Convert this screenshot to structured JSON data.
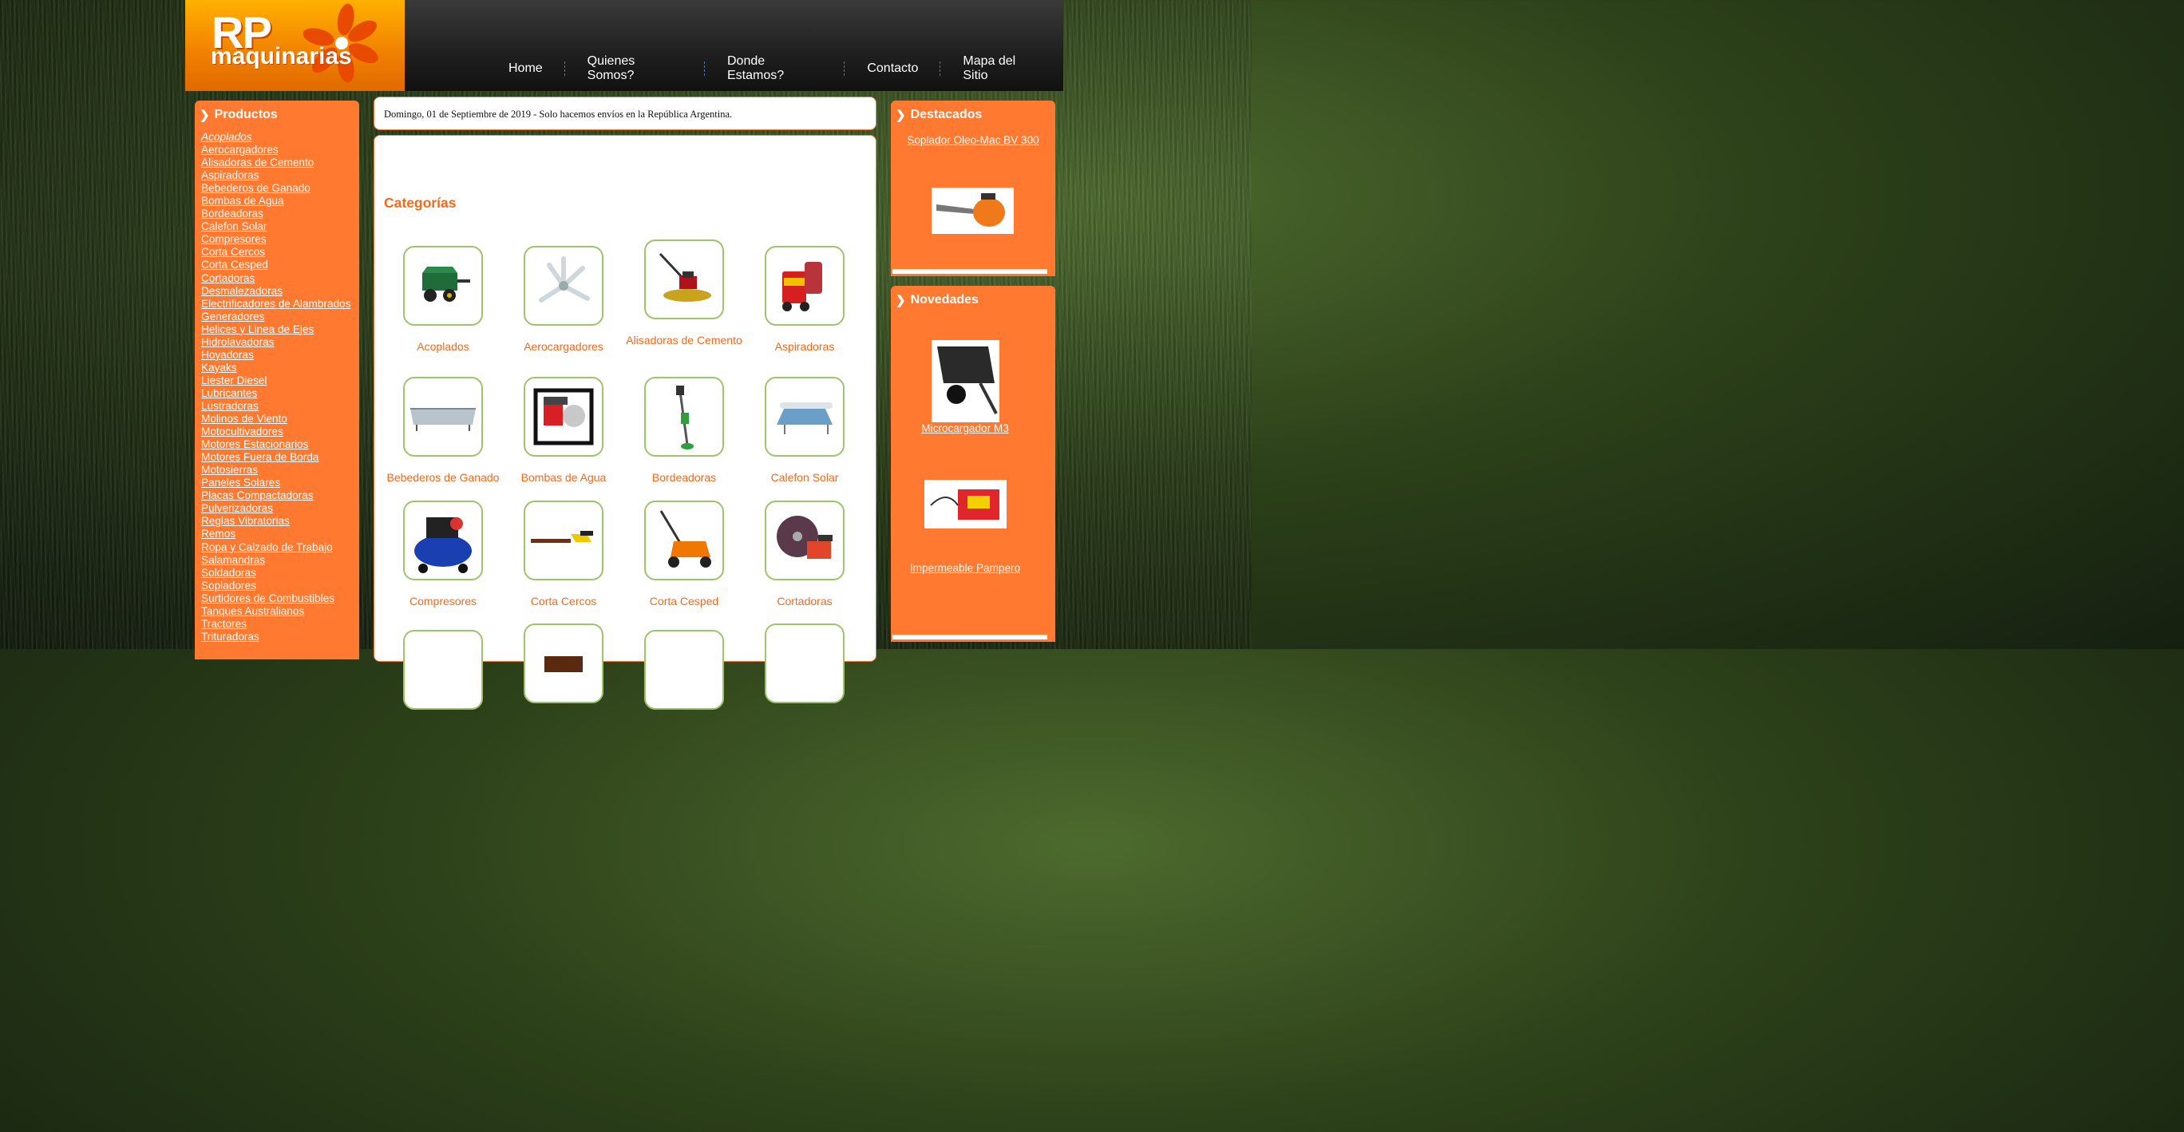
{
  "logo": {
    "line1": "RP",
    "line2": "maquinarias"
  },
  "nav": [
    "Home",
    "Quienes Somos?",
    "Donde Estamos?",
    "Contacto",
    "Mapa del Sitio"
  ],
  "products": {
    "title": "Productos",
    "items": [
      "Acoplados",
      "Aerocargadores",
      "Alisadoras de Cemento",
      "Aspiradoras",
      "Bebederos de Ganado",
      "Bombas de Agua",
      "Bordeadoras",
      "Calefon Solar",
      "Compresores",
      "Corta Cercos",
      "Corta Cesped",
      "Cortadoras",
      "Desmalezadoras",
      "Electrificadores de Alambrados",
      "Generadores",
      "Helices y Linea de Ejes",
      "Hidrolavadoras",
      "Hoyadoras",
      "Kayaks",
      "Liester Diesel",
      "Lubricantes",
      "Lustradoras",
      "Molinos de Viento",
      "Motocultivadores",
      "Motores Estacionarios",
      "Motores Fuera de Borda",
      "Motosierras",
      "Paneles Solares",
      "Placas Compactadoras",
      "Pulverizadoras",
      "Reglas Vibratorias",
      "Remos",
      "Ropa y Calzado de Trabajo",
      "Salamandras",
      "Soldadoras",
      "Sopladores",
      "Surtidores de Combustibles",
      "Tanques Australianos",
      "Tractores",
      "Trituradoras"
    ]
  },
  "date_notice": "Domingo, 01 de Septiembre de 2019  - Solo hacemos envíos en la República Argentina.",
  "categories": {
    "title": "Categorías",
    "items": [
      "Acoplados",
      "Aerocargadores",
      "Alisadoras de Cemento",
      "Aspiradoras",
      "Bebederos de Ganado",
      "Bombas de Agua",
      "Bordeadoras",
      "Calefon Solar",
      "Compresores",
      "Corta Cercos",
      "Corta Cesped",
      "Cortadoras"
    ]
  },
  "destacados": {
    "title": "Destacados",
    "item": "Soplador Oleo-Mac BV 300"
  },
  "novedades": {
    "title": "Novedades",
    "items": [
      "Microcargador M3",
      "Impermeable Pampero"
    ]
  },
  "colors": {
    "orange": "#ff7a30",
    "accent": "#f26a1b",
    "thumb_border": "#9cc46a"
  }
}
